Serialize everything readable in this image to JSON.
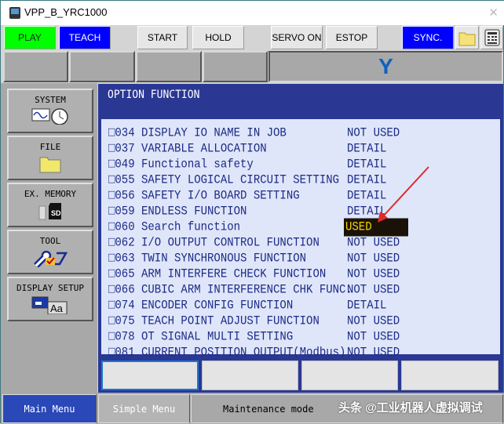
{
  "window": {
    "title": "VPP_B_YRC1000"
  },
  "toolbar": {
    "play": "PLAY",
    "teach": "TEACH",
    "start": "START",
    "hold": "HOLD",
    "servo_on": "SERVO ON",
    "estop": "ESTOP",
    "sync": "SYNC.",
    "colors": {
      "play": "#00ff00",
      "teach": "#0000ff",
      "sync": "#0000ff"
    }
  },
  "status_panel": {
    "robot_type": "Y"
  },
  "left_menu": [
    {
      "label": "SYSTEM",
      "icon": "system-clock-icon"
    },
    {
      "label": "FILE",
      "icon": "folder-icon"
    },
    {
      "label": "EX. MEMORY",
      "icon": "sd-card-icon"
    },
    {
      "label": "TOOL",
      "icon": "tool-icon"
    },
    {
      "label": "DISPLAY SETUP",
      "icon": "display-font-icon"
    }
  ],
  "main": {
    "title": "OPTION FUNCTION",
    "rows": [
      {
        "label": "□034 DISPLAY IO NAME IN JOB",
        "value": "NOT USED"
      },
      {
        "label": "□037 VARIABLE ALLOCATION",
        "value": "DETAIL"
      },
      {
        "label": "□049 Functional safety",
        "value": "DETAIL"
      },
      {
        "label": "□055 SAFETY LOGICAL CIRCUIT SETTING",
        "value": "DETAIL"
      },
      {
        "label": "□056 SAFETY I/O BOARD SETTING",
        "value": "DETAIL"
      },
      {
        "label": "□059 ENDLESS FUNCTION",
        "value": "DETAIL"
      },
      {
        "label": "□060 Search function",
        "value": "USED",
        "selected": true
      },
      {
        "label": "□062 I/O OUTPUT CONTROL FUNCTION",
        "value": "NOT USED"
      },
      {
        "label": "□063 TWIN SYNCHRONOUS FUNCTION",
        "value": "NOT USED"
      },
      {
        "label": "□065 ARM INTERFERE CHECK FUNCTION",
        "value": "NOT USED"
      },
      {
        "label": "□066 CUBIC ARM INTERFERENCE CHK FUNC.",
        "value": "NOT USED"
      },
      {
        "label": "□074 ENCODER CONFIG FUNCTION",
        "value": "DETAIL"
      },
      {
        "label": "□075 TEACH POINT ADJUST FUNCTION",
        "value": "NOT USED"
      },
      {
        "label": "□078 OT SIGNAL MULTI SETTING",
        "value": "NOT USED"
      },
      {
        "label": "□081 CURRENT POSITION OUTPUT(Modbus)",
        "value": "NOT USED"
      }
    ]
  },
  "bottom": {
    "main_menu": "Main Menu",
    "simple_menu": "Simple Menu",
    "mode": "Maintenance mode",
    "watermark": "头条 @工业机器人虚拟调试"
  }
}
